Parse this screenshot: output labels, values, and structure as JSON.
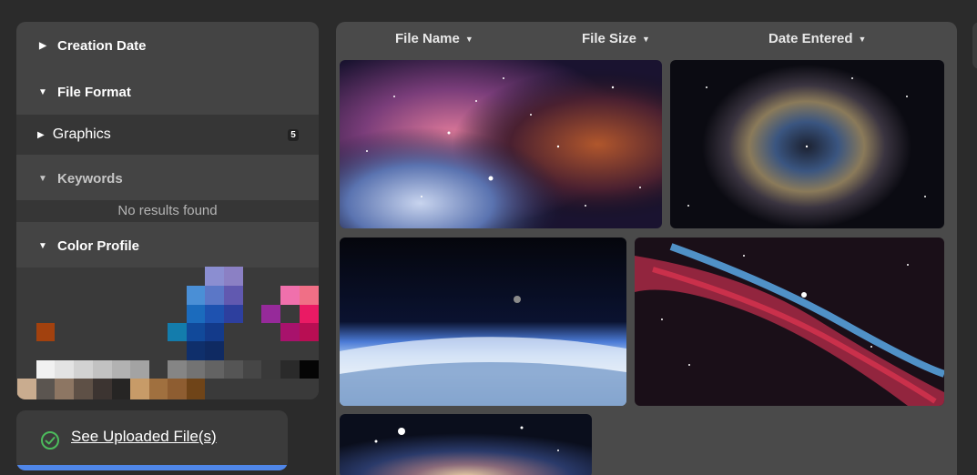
{
  "filters": {
    "creation_date": "Creation Date",
    "file_format": "File Format",
    "graphics": "Graphics",
    "graphics_count": "5",
    "keywords": "Keywords",
    "no_results": "No results found",
    "color_profile": "Color Profile"
  },
  "table": {
    "col_file_name": "File Name",
    "col_file_size": "File Size",
    "col_date_entered": "Date Entered"
  },
  "upload": {
    "link_label": "See Uploaded File(s)"
  },
  "icons": {
    "caret_right": "▶",
    "caret_down": "▼",
    "sort": "▼",
    "check": "check-circle-icon"
  },
  "colors": {
    "accent_bar": "#4f86e8",
    "check_green": "#4cbb5c"
  }
}
